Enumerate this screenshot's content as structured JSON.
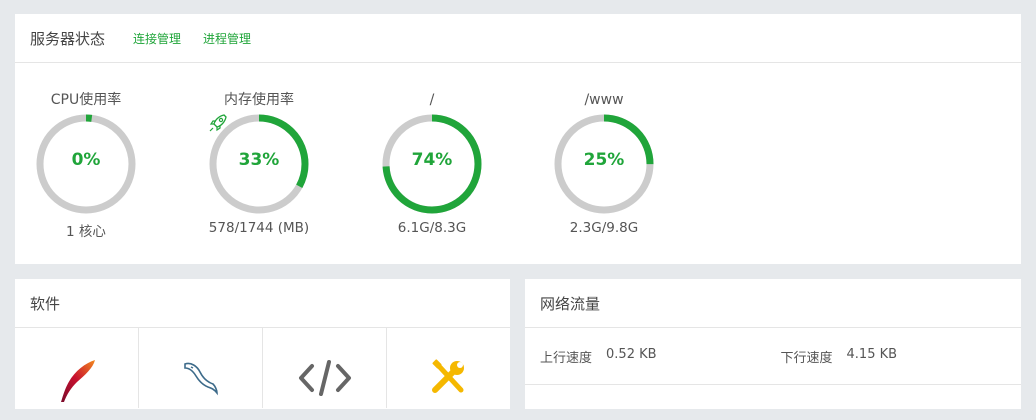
{
  "status": {
    "title": "服务器状态",
    "links": [
      "连接管理",
      "进程管理"
    ],
    "gauges": [
      {
        "label": "CPU使用率",
        "value": "0%",
        "percent": 0.02,
        "sub": "1 核心",
        "icon": ""
      },
      {
        "label": "内存使用率",
        "value": "33%",
        "percent": 0.33,
        "sub": "578/1744 (MB)",
        "icon": "rocket-icon"
      },
      {
        "label": "/",
        "value": "74%",
        "percent": 0.74,
        "sub": "6.1G/8.3G",
        "icon": ""
      },
      {
        "label": "/www",
        "value": "25%",
        "percent": 0.25,
        "sub": "2.3G/9.8G",
        "icon": ""
      }
    ]
  },
  "software": {
    "title": "软件",
    "items": [
      {
        "icon": "apache-feather-icon"
      },
      {
        "icon": "mysql-dolphin-icon"
      },
      {
        "icon": "code-brackets-icon"
      },
      {
        "icon": "tools-icon"
      }
    ]
  },
  "network": {
    "title": "网络流量",
    "up_label": "上行速度",
    "up_value": "0.52 KB",
    "down_label": "下行速度",
    "down_value": "4.15 KB"
  },
  "colors": {
    "accent": "#20a53a",
    "track": "#cccccc",
    "tools": "#f5b800"
  }
}
